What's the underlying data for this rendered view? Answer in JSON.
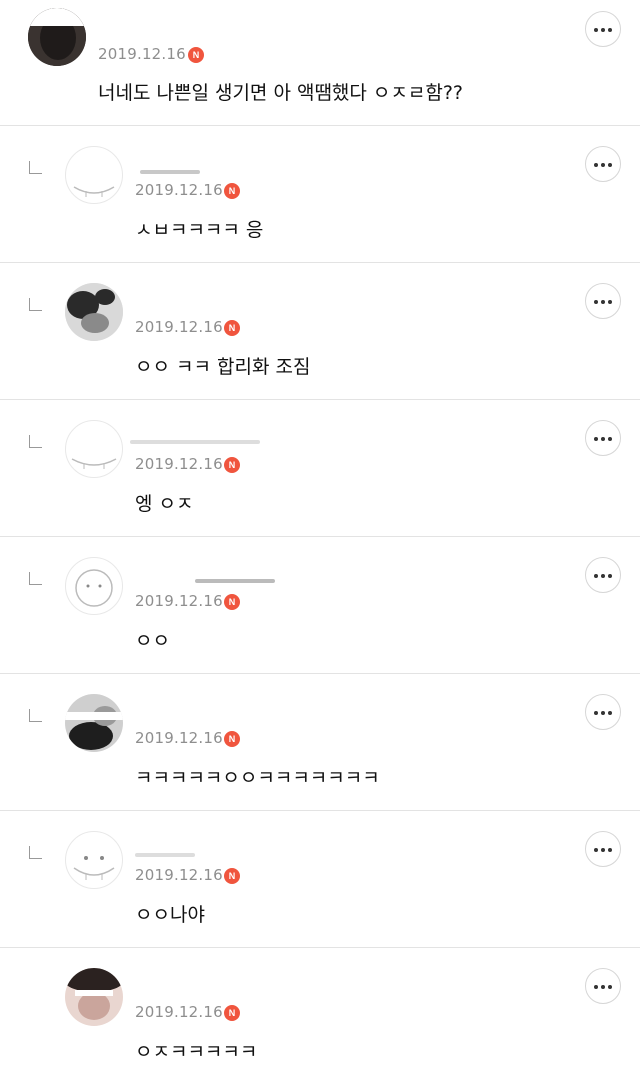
{
  "comments": [
    {
      "date": "2019.12.16",
      "badge": "N",
      "text": "너네도 나쁜일 생기면 아 액땜했다 ㅇㅈㄹ함??"
    },
    {
      "date": "2019.12.16",
      "badge": "N",
      "text": "ㅅㅂㅋㅋㅋㅋ 응"
    },
    {
      "date": "2019.12.16",
      "badge": "N",
      "text": "ㅇㅇ ㅋㅋ 합리화 조짐"
    },
    {
      "date": "2019.12.16",
      "badge": "N",
      "text": "엥 ㅇㅈ"
    },
    {
      "date": "2019.12.16",
      "badge": "N",
      "text": "ㅇㅇ"
    },
    {
      "date": "2019.12.16",
      "badge": "N",
      "text": "ㅋㅋㅋㅋㅋㅇㅇㅋㅋㅋㅋㅋㅋㅋ"
    },
    {
      "date": "2019.12.16",
      "badge": "N",
      "text": "ㅇㅇ나야"
    },
    {
      "date": "2019.12.16",
      "badge": "N",
      "text": "ㅇㅈㅋㅋㅋㅋㅋ"
    }
  ],
  "icons": {
    "more": "more-dots-icon",
    "reply": "reply-arrow-icon",
    "badge": "new-badge-icon"
  },
  "colors": {
    "badge": "#f0553e",
    "date": "#8e8e8e",
    "divider": "#e3e3e3"
  }
}
